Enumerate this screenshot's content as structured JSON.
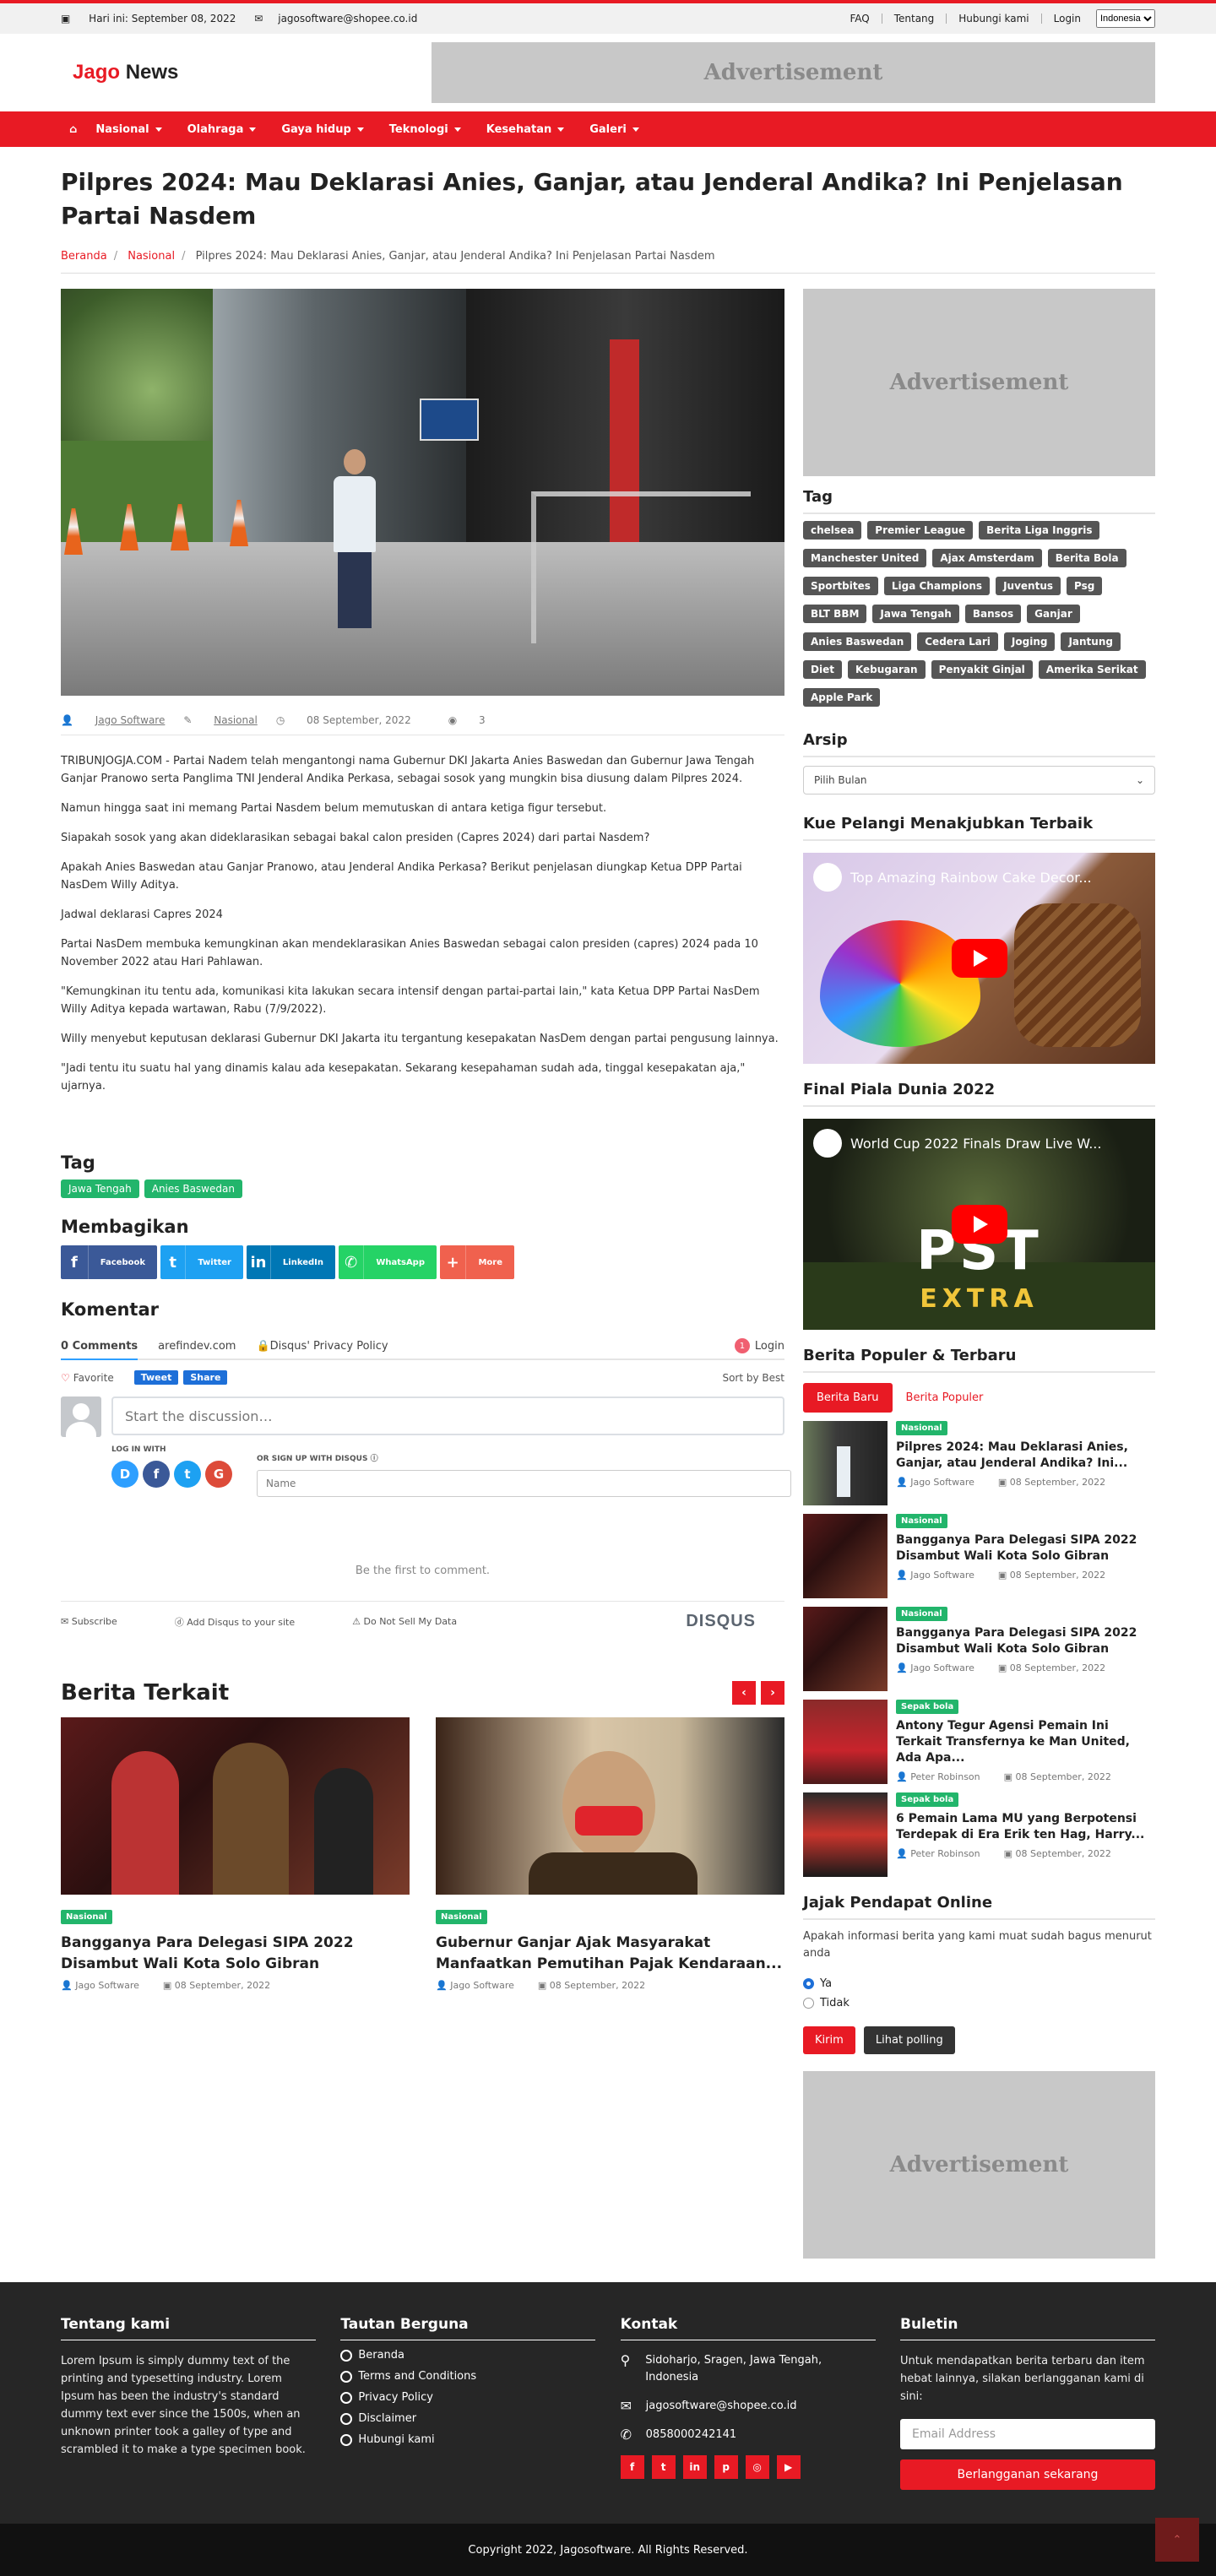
{
  "topbar": {
    "date": "Hari ini: September 08, 2022",
    "email": "jagosoftware@shopee.co.id",
    "links": [
      "FAQ",
      "Tentang",
      "Hubungi kami",
      "Login"
    ],
    "language": "Indonesia"
  },
  "header": {
    "logo_a": "Jago",
    "logo_b": "News",
    "ad": "Advertisement"
  },
  "nav": {
    "items": [
      "Nasional",
      "Olahraga",
      "Gaya hidup",
      "Teknologi",
      "Kesehatan",
      "Galeri"
    ]
  },
  "article": {
    "title": "Pilpres 2024: Mau Deklarasi Anies, Ganjar, atau Jenderal Andika? Ini Penjelasan Partai Nasdem",
    "breadcrumb": [
      "Beranda",
      "Nasional",
      "Pilpres 2024: Mau Deklarasi Anies, Ganjar, atau Jenderal Andika? Ini Penjelasan Partai Nasdem"
    ],
    "author": "Jago Software",
    "category": "Nasional",
    "date": "08 September, 2022",
    "views": "3",
    "paragraphs": [
      "TRIBUNJOGJA.COM - Partai Nadem telah mengantongi nama Gubernur DKI Jakarta Anies Baswedan dan Gubernur Jawa Tengah Ganjar Pranowo serta Panglima TNI Jenderal Andika Perkasa, sebagai sosok yang mungkin bisa diusung dalam Pilpres 2024.",
      "Namun hingga saat ini memang Partai Nasdem belum memutuskan di antara ketiga figur tersebut.",
      "Siapakah sosok yang akan dideklarasikan sebagai bakal calon presiden (Capres 2024) dari partai Nasdem?",
      "Apakah Anies Baswedan atau Ganjar Pranowo, atau Jenderal Andika Perkasa? Berikut penjelasan diungkap Ketua DPP Partai NasDem Willy Aditya.",
      "Jadwal deklarasi Capres 2024",
      "Partai NasDem membuka kemungkinan akan mendeklarasikan Anies Baswedan sebagai calon presiden (capres) 2024 pada 10 November 2022 atau Hari Pahlawan.",
      "\"Kemungkinan itu tentu ada, komunikasi kita lakukan secara intensif dengan partai-partai lain,\" kata Ketua DPP Partai NasDem Willy Aditya kepada wartawan, Rabu (7/9/2022).",
      "Willy menyebut keputusan deklarasi Gubernur DKI Jakarta itu tergantung kesepakatan NasDem dengan partai pengusung lainnya.",
      "\"Jadi tentu itu suatu hal yang dinamis kalau ada kesepakatan. Sekarang kesepahaman sudah ada, tinggal kesepakatan aja,\" ujarnya."
    ],
    "tag_heading": "Tag",
    "tags": [
      "Jawa Tengah",
      "Anies Baswedan"
    ],
    "share_heading": "Membagikan",
    "share": [
      {
        "label": "Facebook",
        "color": "#3b5998",
        "icon": "f"
      },
      {
        "label": "Twitter",
        "color": "#1da1f2",
        "icon": "t"
      },
      {
        "label": "LinkedIn",
        "color": "#0077b5",
        "icon": "in"
      },
      {
        "label": "WhatsApp",
        "color": "#25d366",
        "icon": "w"
      },
      {
        "label": "More",
        "color": "#f0614e",
        "icon": "+"
      }
    ]
  },
  "comments": {
    "heading": "Komentar",
    "count": "0 Comments",
    "site": "arefindev.com",
    "policy": "Disqus' Privacy Policy",
    "login": "Login",
    "favorite": "Favorite",
    "tweet": "Tweet",
    "share": "Share",
    "sort": "Sort by Best",
    "placeholder": "Start the discussion…",
    "login_with": "LOG IN WITH",
    "signup": "OR SIGN UP WITH DISQUS",
    "name_placeholder": "Name",
    "empty": "Be the first to comment.",
    "subscribe": "Subscribe",
    "add": "Add Disqus to your site",
    "dnsmd": "Do Not Sell My Data",
    "brand": "DISQUS",
    "badge": "1"
  },
  "related": {
    "heading": "Berita Terkait",
    "items": [
      {
        "badge": "Nasional",
        "title": "Bangganya Para Delegasi SIPA 2022 Disambut Wali Kota Solo Gibran",
        "author": "Jago Software",
        "date": "08 September, 2022"
      },
      {
        "badge": "Nasional",
        "title": "Gubernur Ganjar Ajak Masyarakat Manfaatkan Pemutihan Pajak Kendaraan...",
        "author": "Jago Software",
        "date": "08 September, 2022"
      }
    ]
  },
  "sidebar": {
    "ad": "Advertisement",
    "tag_heading": "Tag",
    "tags": [
      "chelsea",
      "Premier League",
      "Berita Liga Inggris",
      "Manchester United",
      "Ajax Amsterdam",
      "Berita Bola",
      "Sportbites",
      "Liga Champions",
      "Juventus",
      "Psg",
      "BLT BBM",
      "Jawa Tengah",
      "Bansos",
      "Ganjar",
      "Anies Baswedan",
      "Cedera Lari",
      "Joging",
      "Jantung",
      "Diet",
      "Kebugaran",
      "Penyakit Ginjal",
      "Amerika Serikat",
      "Apple Park"
    ],
    "archive_heading": "Arsip",
    "archive_select": "Pilih Bulan",
    "video1_heading": "Kue Pelangi Menakjubkan Terbaik",
    "video1_title": "Top Amazing Rainbow Cake Decor...",
    "video2_heading": "Final Piala Dunia 2022",
    "video2_title": "World Cup 2022 Finals Draw Live W...",
    "video2_overlay": "PST",
    "video2_extra": "EXTRA",
    "popular_heading": "Berita Populer & Terbaru",
    "tab_new": "Berita Baru",
    "tab_pop": "Berita Populer",
    "news": [
      {
        "badge": "Nasional",
        "title": "Pilpres 2024: Mau Deklarasi Anies, Ganjar, atau Jenderal Andika? Ini...",
        "author": "Jago Software",
        "date": "08 September, 2022"
      },
      {
        "badge": "Nasional",
        "title": "Bangganya Para Delegasi SIPA 2022 Disambut Wali Kota Solo Gibran",
        "author": "Jago Software",
        "date": "08 September, 2022"
      },
      {
        "badge": "Nasional",
        "title": "Bangganya Para Delegasi SIPA 2022 Disambut Wali Kota Solo Gibran",
        "author": "Jago Software",
        "date": "08 September, 2022"
      },
      {
        "badge": "Sepak bola",
        "title": "Antony Tegur Agensi Pemain Ini Terkait Transfernya ke Man United, Ada Apa...",
        "author": "Peter Robinson",
        "date": "08 September, 2022"
      },
      {
        "badge": "Sepak bola",
        "title": "6 Pemain Lama MU yang Berpotensi Terdepak di Era Erik ten Hag, Harry...",
        "author": "Peter Robinson",
        "date": "08 September, 2022"
      }
    ],
    "poll_heading": "Jajak Pendapat Online",
    "poll_question": "Apakah informasi berita yang kami muat sudah bagus menurut anda",
    "poll_yes": "Ya",
    "poll_no": "Tidak",
    "poll_submit": "Kirim",
    "poll_view": "Lihat polling",
    "ad2": "Advertisement"
  },
  "footer": {
    "about_heading": "Tentang kami",
    "about_text": "Lorem Ipsum is simply dummy text of the printing and typesetting industry. Lorem Ipsum has been the industry's standard dummy text ever since the 1500s, when an unknown printer took a galley of type and scrambled it to make a type specimen book.",
    "links_heading": "Tautan Berguna",
    "links": [
      "Beranda",
      "Terms and Conditions",
      "Privacy Policy",
      "Disclaimer",
      "Hubungi kami"
    ],
    "contact_heading": "Kontak",
    "address": "Sidoharjo, Sragen, Jawa Tengah, Indonesia",
    "email": "jagosoftware@shopee.co.id",
    "phone": "0858000242141",
    "newsletter_heading": "Buletin",
    "newsletter_text": "Untuk mendapatkan berita terbaru dan item hebat lainnya, silakan berlangganan kami di sini:",
    "email_placeholder": "Email Address",
    "subscribe": "Berlangganan sekarang",
    "copyright": "Copyright 2022, Jagosoftware. All Rights Reserved."
  },
  "colors": {
    "brand": "#e81a24",
    "tag_green": "#22b56b",
    "footer_bg": "#262626"
  }
}
